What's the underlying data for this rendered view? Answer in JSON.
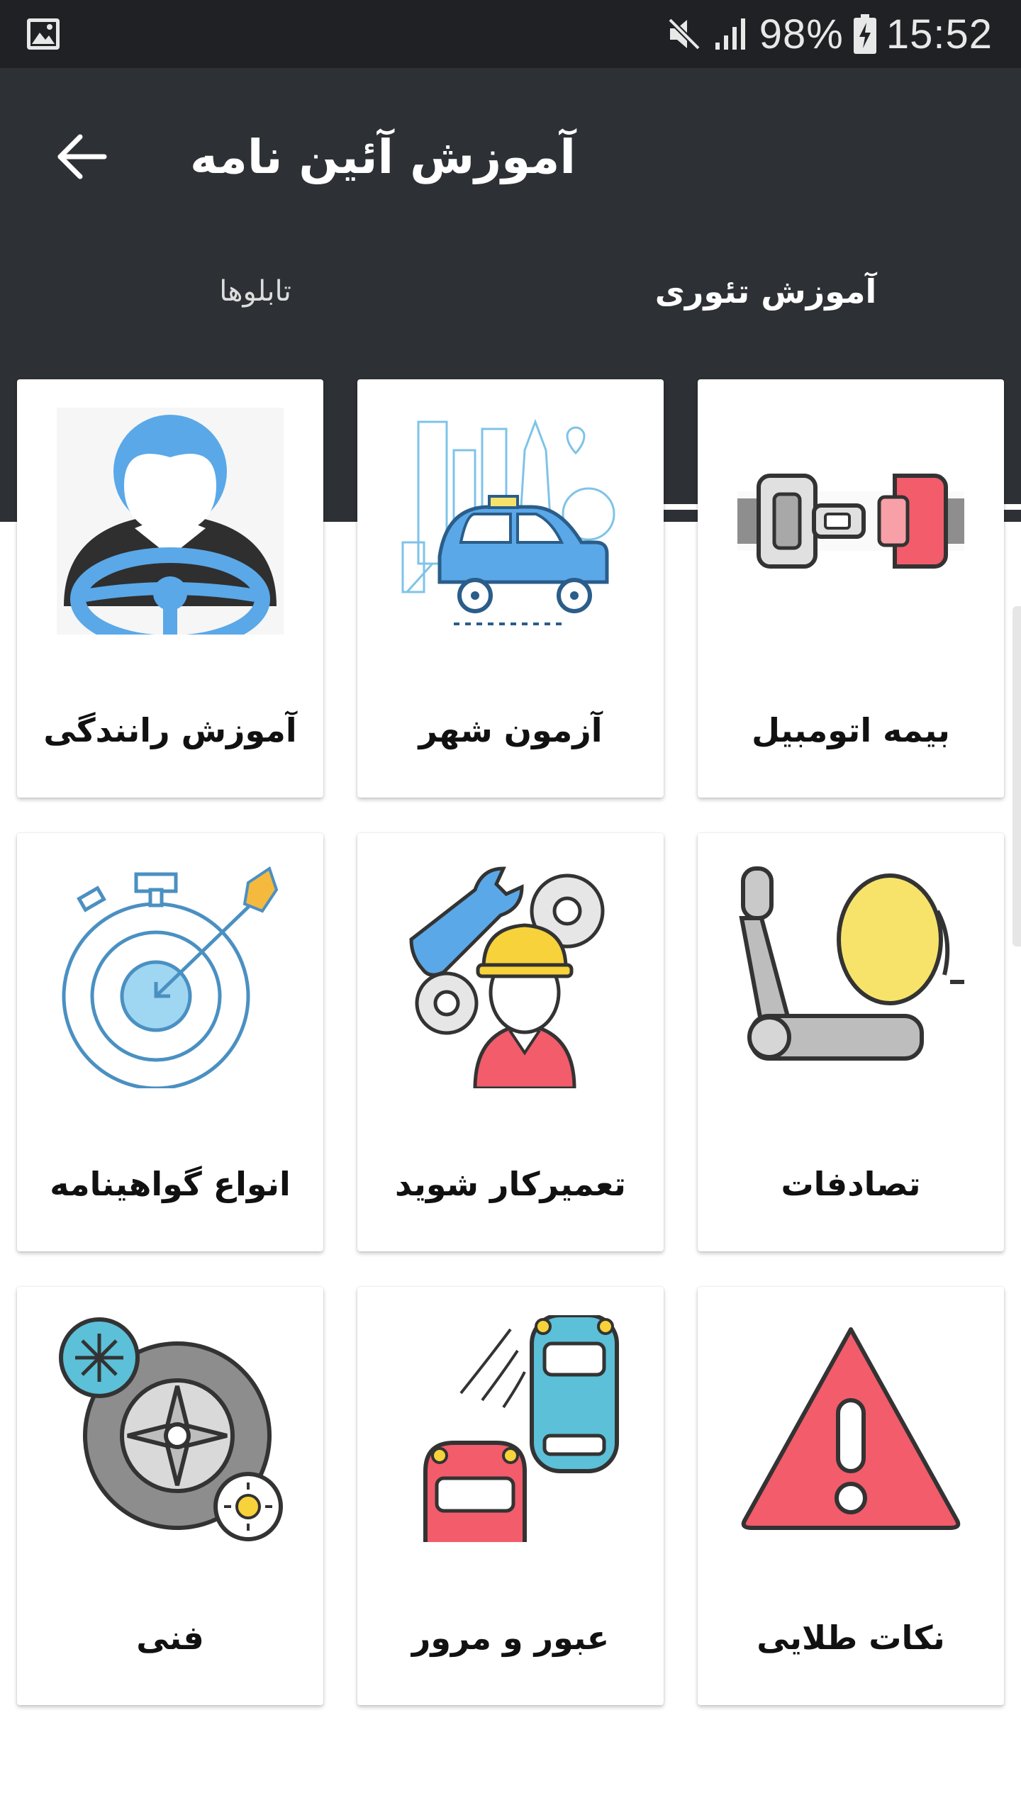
{
  "status_bar": {
    "battery": "98%",
    "time": "15:52"
  },
  "app_bar": {
    "title": "آموزش آئین نامه"
  },
  "tabs": [
    {
      "label": "آموزش تئوری",
      "selected": true
    },
    {
      "label": "تابلوها",
      "selected": false
    }
  ],
  "cards": [
    {
      "label": "بیمه اتومبیل",
      "icon": "seatbelt-icon"
    },
    {
      "label": "آزمون شهر",
      "icon": "city-car-icon"
    },
    {
      "label": "آموزش رانندگی",
      "icon": "driver-icon"
    },
    {
      "label": "تصادفات",
      "icon": "airbag-seat-icon"
    },
    {
      "label": "تعمیرکار شوید",
      "icon": "mechanic-icon"
    },
    {
      "label": "انواع گواهینامه",
      "icon": "target-stopwatch-icon"
    },
    {
      "label": "نکات طلایی",
      "icon": "warning-triangle-icon"
    },
    {
      "label": "عبور و مرور",
      "icon": "traffic-cars-icon"
    },
    {
      "label": "فنی",
      "icon": "tire-icon"
    }
  ],
  "colors": {
    "status_bar_bg": "#1f2124",
    "app_bar_bg": "#2d3135",
    "tab_indicator": "#ffffff",
    "accent_blue": "#5aa8e8",
    "accent_red": "#f25c6b",
    "accent_yellow": "#f7e36a"
  }
}
